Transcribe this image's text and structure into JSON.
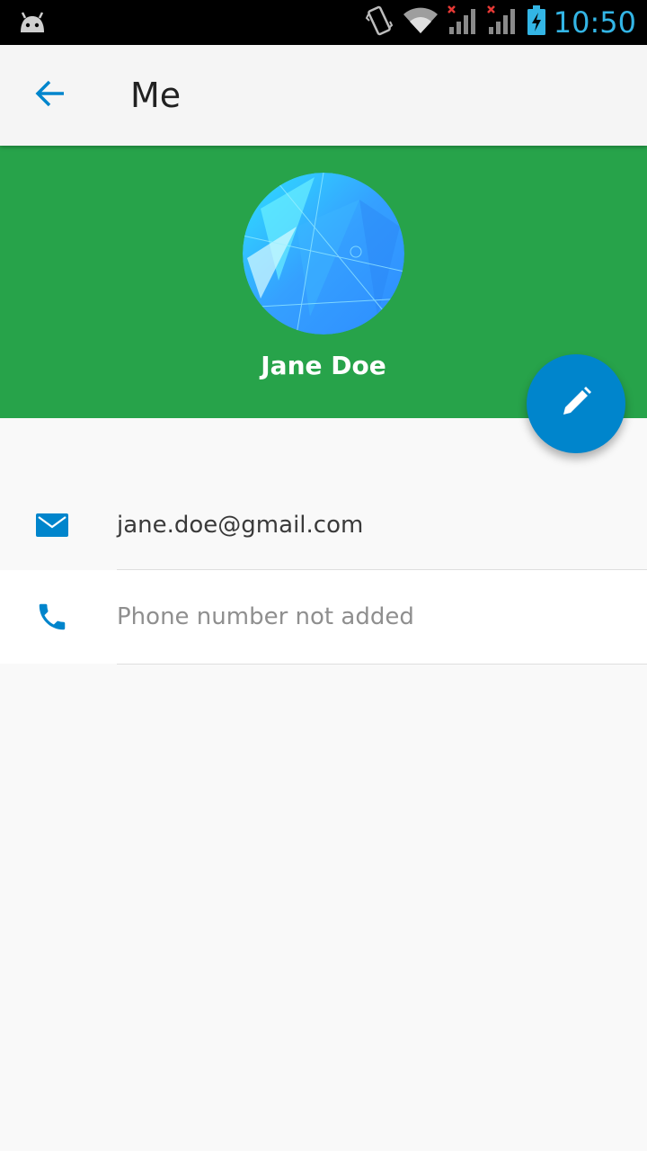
{
  "status_bar": {
    "time": "10:50",
    "icons": [
      "android-icon",
      "vibrate-icon",
      "wifi-icon",
      "signal-no-sim-icon",
      "signal-no-sim-icon",
      "battery-charging-icon"
    ]
  },
  "app_bar": {
    "back_icon": "arrow-back-icon",
    "title": "Me"
  },
  "profile": {
    "name": "Jane Doe",
    "header_color": "#27a34a"
  },
  "fab": {
    "icon": "pencil-icon",
    "color": "#0085cc"
  },
  "contact": {
    "email": {
      "icon": "mail-icon",
      "value": "jane.doe@gmail.com"
    },
    "phone": {
      "icon": "phone-icon",
      "placeholder": "Phone number not added"
    }
  },
  "colors": {
    "accent": "#0085cc",
    "status_time": "#33b5e5"
  }
}
